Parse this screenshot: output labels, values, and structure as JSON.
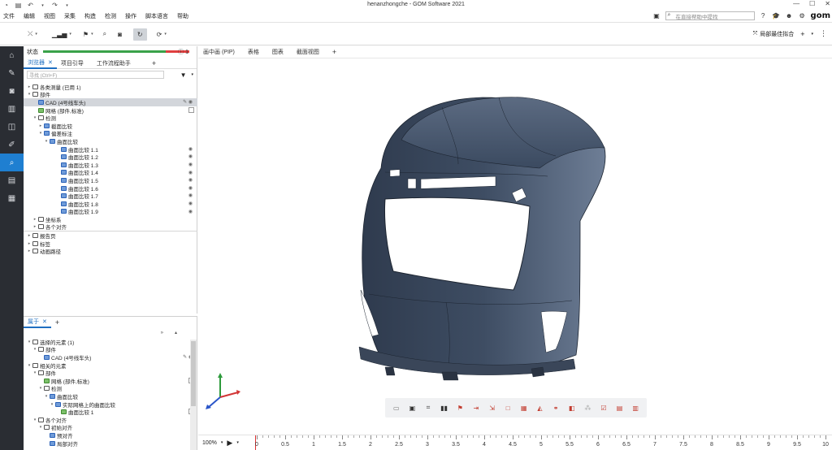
{
  "window": {
    "title": "henanzhongche - GOM Software 2021",
    "controls": [
      "minimize",
      "maximize",
      "close"
    ]
  },
  "menu": {
    "items": [
      "文件",
      "编辑",
      "视图",
      "采集",
      "构造",
      "检测",
      "操作",
      "脚本语言",
      "帮助"
    ],
    "search_placeholder": "在直接帮助中提找"
  },
  "toolbar": {
    "right_label": "局部最佳拟合"
  },
  "explorer": {
    "status_label": "状态",
    "status_progress": 0.84,
    "info_count": "1",
    "tabs": [
      "浏览器",
      "项目引导",
      "工作流程助手"
    ],
    "filter_placeholder": "寻找 (Ctrl+F)",
    "tree": [
      {
        "label": "各类测量 (已用 1)",
        "level": 0,
        "toggle": "▸",
        "icon": "folder"
      },
      {
        "label": "部件",
        "level": 0,
        "toggle": "▾",
        "icon": "folder"
      },
      {
        "label": "CAD (4号线车头)",
        "level": 1,
        "toggle": "",
        "icon": "blue",
        "selected": true,
        "right": "✎ ◉"
      },
      {
        "label": "网格 (部件,标准)",
        "level": 1,
        "toggle": "",
        "icon": "green",
        "check": true
      },
      {
        "label": "检测",
        "level": 1,
        "toggle": "▾",
        "icon": "folder"
      },
      {
        "label": "截面比较",
        "level": 2,
        "toggle": "▸",
        "icon": "blue"
      },
      {
        "label": "偏差标注",
        "level": 2,
        "toggle": "▾",
        "icon": "blue"
      },
      {
        "label": "曲面比较",
        "level": 3,
        "toggle": "▾",
        "icon": "blue"
      },
      {
        "label": "曲面比较 1.1",
        "level": 5,
        "toggle": "",
        "icon": "blue",
        "right": "◉"
      },
      {
        "label": "曲面比较 1.2",
        "level": 5,
        "toggle": "",
        "icon": "blue",
        "right": "◉"
      },
      {
        "label": "曲面比较 1.3",
        "level": 5,
        "toggle": "",
        "icon": "blue",
        "right": "◉"
      },
      {
        "label": "曲面比较 1.4",
        "level": 5,
        "toggle": "",
        "icon": "blue",
        "right": "◉"
      },
      {
        "label": "曲面比较 1.5",
        "level": 5,
        "toggle": "",
        "icon": "blue",
        "right": "◉"
      },
      {
        "label": "曲面比较 1.6",
        "level": 5,
        "toggle": "",
        "icon": "blue",
        "right": "◉"
      },
      {
        "label": "曲面比较 1.7",
        "level": 5,
        "toggle": "",
        "icon": "blue",
        "right": "◉"
      },
      {
        "label": "曲面比较 1.8",
        "level": 5,
        "toggle": "",
        "icon": "blue",
        "right": "◉"
      },
      {
        "label": "曲面比较 1.9",
        "level": 5,
        "toggle": "",
        "icon": "blue",
        "right": "◉"
      },
      {
        "label": "坐标系",
        "level": 1,
        "toggle": "▸",
        "icon": "folder"
      },
      {
        "label": "各个对齐",
        "level": 1,
        "toggle": "▸",
        "icon": "folder"
      },
      {
        "label": "报告页",
        "level": 0,
        "toggle": "▸",
        "icon": "folder"
      },
      {
        "label": "标签",
        "level": 0,
        "toggle": "▸",
        "icon": "folder"
      },
      {
        "label": "动画路径",
        "level": 0,
        "toggle": "▸",
        "icon": "folder"
      }
    ]
  },
  "properties": {
    "tab_label": "属于",
    "tree": [
      {
        "label": "选择的元素 (1)",
        "level": 0,
        "toggle": "▾",
        "icon": "folder"
      },
      {
        "label": "部件",
        "level": 1,
        "toggle": "▾",
        "icon": "folder"
      },
      {
        "label": "CAD (4号线车头)",
        "level": 2,
        "toggle": "",
        "icon": "blue",
        "right": "✎ ◉"
      },
      {
        "label": "相关的元素",
        "level": 0,
        "toggle": "▾",
        "icon": "folder"
      },
      {
        "label": "部件",
        "level": 1,
        "toggle": "▾",
        "icon": "folder"
      },
      {
        "label": "网格 (部件,标准)",
        "level": 2,
        "toggle": "",
        "icon": "green",
        "check": true
      },
      {
        "label": "检测",
        "level": 2,
        "toggle": "▾",
        "icon": "folder"
      },
      {
        "label": "曲面比较",
        "level": 3,
        "toggle": "▾",
        "icon": "blue"
      },
      {
        "label": "实际网格上的曲面比较",
        "level": 4,
        "toggle": "▾",
        "icon": "blue"
      },
      {
        "label": "曲面比较 1",
        "level": 5,
        "toggle": "",
        "icon": "green",
        "check": true
      },
      {
        "label": "各个对齐",
        "level": 1,
        "toggle": "▾",
        "icon": "folder"
      },
      {
        "label": "初始对齐",
        "level": 2,
        "toggle": "▾",
        "icon": "folder"
      },
      {
        "label": "预对齐",
        "level": 3,
        "toggle": "",
        "icon": "blue"
      },
      {
        "label": "局部对齐",
        "level": 3,
        "toggle": "",
        "icon": "blue"
      }
    ]
  },
  "viewport": {
    "tabs": [
      "画中画 (PIP)",
      "表格",
      "图表",
      "截面视图"
    ],
    "zoom": "100%",
    "timeline_labels": [
      "0",
      "0.5",
      "1",
      "1.5",
      "2",
      "2.5",
      "3",
      "3.5",
      "4",
      "4.5",
      "5",
      "5.5",
      "6",
      "6.5",
      "7",
      "7.5",
      "8",
      "8.5",
      "9",
      "9.5",
      "10"
    ]
  },
  "colors": {
    "accent": "#1f7fd1",
    "sidebar_bg": "#2a2d33",
    "model": "#3e4d63",
    "status_ok": "#3aa24a",
    "status_bad": "#e04040"
  }
}
